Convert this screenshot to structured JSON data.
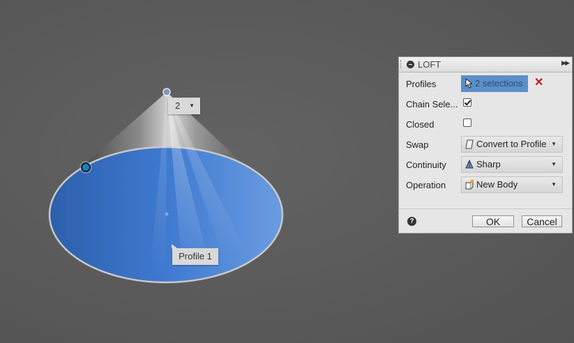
{
  "viewport": {
    "count_value": "2",
    "profile_tooltip": "Profile 1"
  },
  "dialog": {
    "title": "LOFT",
    "rows": {
      "profiles": {
        "label": "Profiles",
        "value": "2 selections"
      },
      "chain_selection": {
        "label": "Chain Sele...",
        "checked": true
      },
      "closed": {
        "label": "Closed",
        "checked": false
      },
      "swap": {
        "label": "Swap",
        "value": "Convert to Profile",
        "icon": "profile-icon"
      },
      "continuity": {
        "label": "Continuity",
        "value": "Sharp",
        "icon": "sharp-icon"
      },
      "operation": {
        "label": "Operation",
        "value": "New Body",
        "icon": "new-body-icon"
      }
    },
    "ok_label": "OK",
    "cancel_label": "Cancel"
  },
  "colors": {
    "profile_fill": "#3d76c6",
    "selection_blue": "#5b8fc9",
    "background": "#5b5b5b"
  }
}
